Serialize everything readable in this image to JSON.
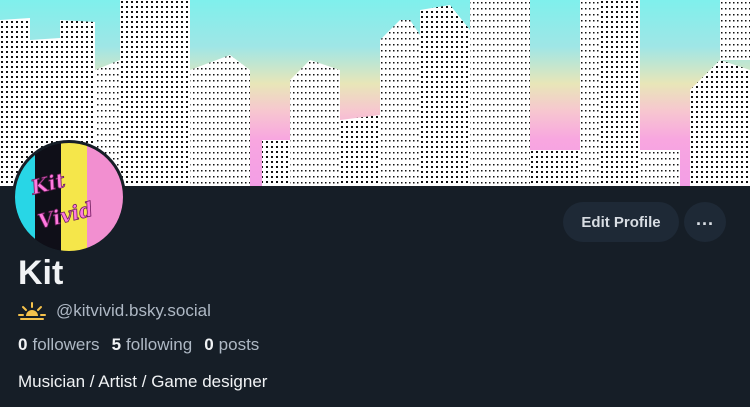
{
  "profile": {
    "display_name": "Kit",
    "handle": "@kitvivid.bsky.social",
    "bio": "Musician / Artist / Game designer",
    "avatar_logo_text": "Kit Vivid",
    "banner_image": "city-skyline-halftone",
    "stats": {
      "followers_count": "0",
      "followers_label": "followers",
      "following_count": "5",
      "following_label": "following",
      "posts_count": "0",
      "posts_label": "posts"
    }
  },
  "actions": {
    "edit_profile_label": "Edit Profile",
    "more_icon": "ellipsis-icon"
  },
  "icons": {
    "handle_badge": "sunrise-icon"
  },
  "colors": {
    "background": "#161e27",
    "button_bg": "#1e2936",
    "text_primary": "#f1f3f5",
    "text_secondary": "#aeb8c4",
    "sun_yellow": "#f5c24b"
  }
}
